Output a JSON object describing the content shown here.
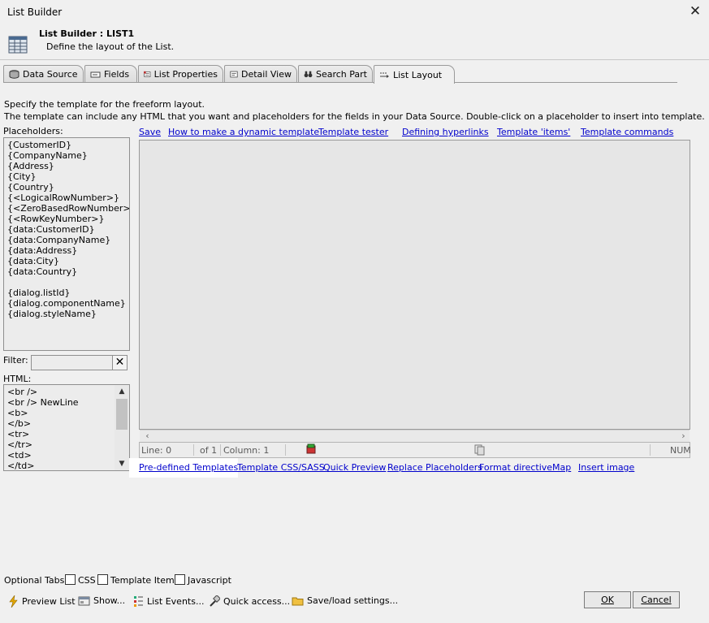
{
  "window": {
    "title": "List Builder",
    "close_icon": "close-icon"
  },
  "header": {
    "title": "List Builder : LIST1",
    "subtitle": "Define the layout of the List."
  },
  "tabs": [
    {
      "label": "Data Source",
      "icon": "database-icon"
    },
    {
      "label": "Fields",
      "icon": "field-icon"
    },
    {
      "label": "List Properties",
      "icon": "properties-icon"
    },
    {
      "label": "Detail View",
      "icon": "detail-icon"
    },
    {
      "label": "Search Part",
      "icon": "binoculars-icon"
    },
    {
      "label": "List Layout",
      "icon": "layout-icon",
      "active": true
    }
  ],
  "description": {
    "line1": "Specify the template for the freeform layout.",
    "line2": "The template can include any HTML that you want and placeholders for the fields in your Data Source. Double-click on a placeholder to insert into template."
  },
  "placeholders": {
    "label": "Placeholders:",
    "items": [
      "{CustomerID}",
      "{CompanyName}",
      "{Address}",
      "{City}",
      "{Country}",
      "{<LogicalRowNumber>}",
      "{<ZeroBasedRowNumber>}",
      "{<RowKeyNumber>}",
      "{data:CustomerID}",
      "{data:CompanyName}",
      "{data:Address}",
      "{data:City}",
      "{data:Country}",
      "",
      "{dialog.listId}",
      "{dialog.componentName}",
      "{dialog.styleName}"
    ]
  },
  "filter": {
    "label": "Filter:",
    "value": "",
    "clear_label": "✕"
  },
  "html_list": {
    "label": "HTML:",
    "items": [
      "<br />",
      "<br /> NewLine",
      "<b>",
      "</b>",
      "<tr>",
      "</tr>",
      "<td>",
      "</td>"
    ]
  },
  "top_links": [
    "Save",
    "How to make a dynamic template",
    "Template tester",
    "Defining hyperlinks",
    "Template 'items'",
    "Template commands"
  ],
  "status_bar": {
    "line": "Line: 0",
    "of": "of 1",
    "column": "Column: 1",
    "num": "NUM"
  },
  "bottom_links": [
    "Pre-defined Templates",
    "Template CSS/SASS",
    "Quick Preview",
    "Replace Placeholders",
    "Format directive",
    "Map",
    "Insert image"
  ],
  "optional_tabs": {
    "label": "Optional Tabs:",
    "items": [
      "CSS",
      "Template Items",
      "Javascript"
    ]
  },
  "actions": {
    "preview": "Preview List",
    "show": "Show...",
    "events": "List Events...",
    "quick": "Quick access...",
    "save_load": "Save/load settings...",
    "ok": "OK",
    "cancel": "Cancel"
  },
  "colors": {
    "link": "#0000cc",
    "background": "#f0f0f0",
    "editor_bg": "#e6e6e6"
  }
}
